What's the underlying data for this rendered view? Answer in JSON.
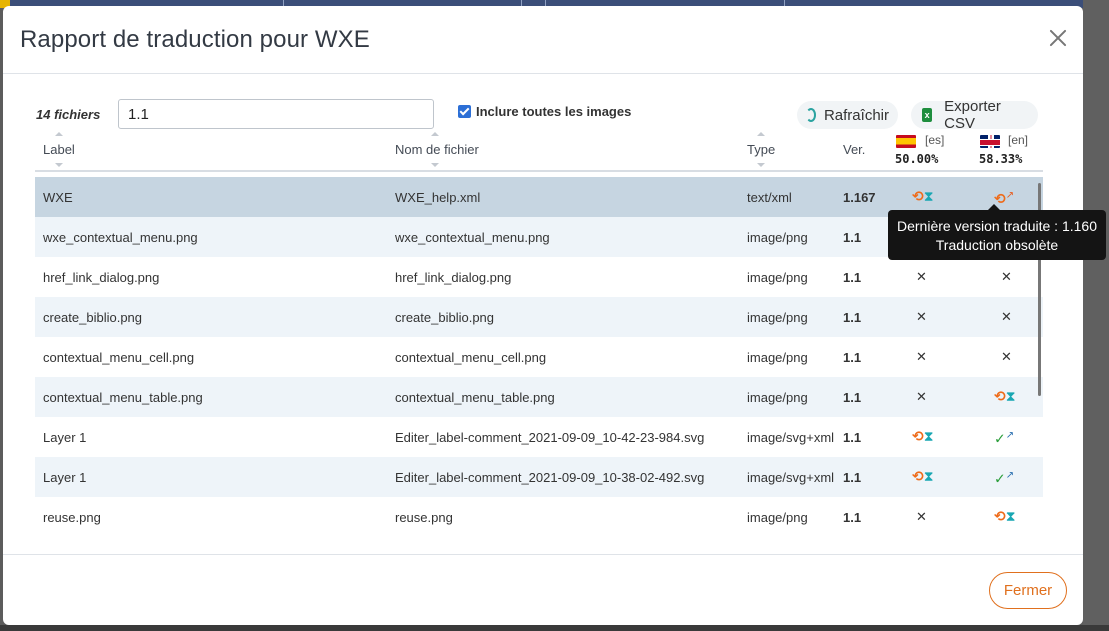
{
  "modal": {
    "title": "Rapport de traduction pour WXE",
    "close_label": "×",
    "files_count": "14 fichiers",
    "filter_value": "1.1",
    "include_images_label": "Inclure toutes les images",
    "include_images_checked": true,
    "refresh_label": "Rafraîchir",
    "export_label": "Exporter CSV",
    "footer_close_label": "Fermer"
  },
  "columns": {
    "label": "Label",
    "filename": "Nom de fichier",
    "type": "Type",
    "version": "Ver."
  },
  "languages": [
    {
      "code": "[es]",
      "flag": "spain-flag",
      "percent": "50.00%"
    },
    {
      "code": "[en]",
      "flag": "uk-flag",
      "percent": "58.33%"
    }
  ],
  "rows": [
    {
      "label": "WXE",
      "filename": "WXE_help.xml",
      "type": "text/xml",
      "version": "1.167",
      "es": "outdated",
      "en": "outdated-link"
    },
    {
      "label": "wxe_contextual_menu.png",
      "filename": "wxe_contextual_menu.png",
      "type": "image/png",
      "version": "1.1",
      "es": "missing",
      "en": "missing"
    },
    {
      "label": "href_link_dialog.png",
      "filename": "href_link_dialog.png",
      "type": "image/png",
      "version": "1.1",
      "es": "missing",
      "en": "missing"
    },
    {
      "label": "create_biblio.png",
      "filename": "create_biblio.png",
      "type": "image/png",
      "version": "1.1",
      "es": "missing",
      "en": "missing"
    },
    {
      "label": "contextual_menu_cell.png",
      "filename": "contextual_menu_cell.png",
      "type": "image/png",
      "version": "1.1",
      "es": "missing",
      "en": "missing"
    },
    {
      "label": "contextual_menu_table.png",
      "filename": "contextual_menu_table.png",
      "type": "image/png",
      "version": "1.1",
      "es": "missing",
      "en": "outdated"
    },
    {
      "label": "Layer 1",
      "filename": "Editer_label-comment_2021-09-09_10-42-23-984.svg",
      "type": "image/svg+xml",
      "version": "1.1",
      "es": "outdated",
      "en": "ok-link"
    },
    {
      "label": "Layer 1",
      "filename": "Editer_label-comment_2021-09-09_10-38-02-492.svg",
      "type": "image/svg+xml",
      "version": "1.1",
      "es": "outdated",
      "en": "ok-link"
    },
    {
      "label": "reuse.png",
      "filename": "reuse.png",
      "type": "image/png",
      "version": "1.1",
      "es": "missing",
      "en": "outdated"
    }
  ],
  "tooltip": {
    "line1": "Dernière version traduite : 1.160",
    "line2": "Traduction obsolète"
  },
  "colors": {
    "accent": "#e0701e",
    "selected_row": "#c6d5e1",
    "alt_row": "#eef4f9",
    "outdated_icon": "#ee6b1a",
    "hourglass_icon": "#19a7b3",
    "ok_icon": "#2a9d3a"
  }
}
